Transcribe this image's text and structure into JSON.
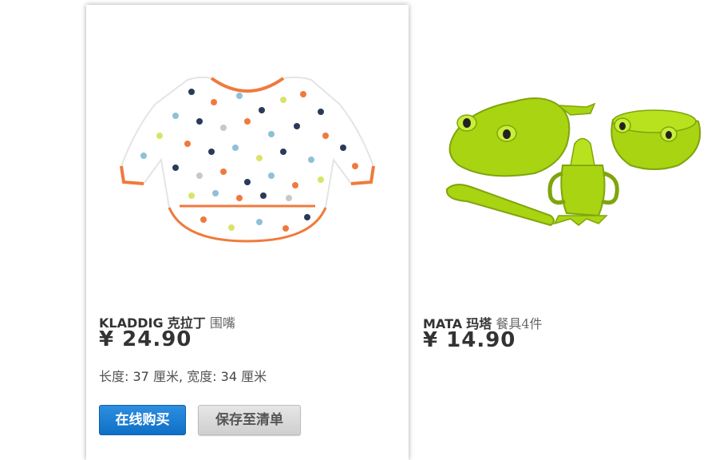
{
  "products": [
    {
      "brand": "KLADDIG",
      "name_cn": "克拉丁",
      "description": "围嘴",
      "price": "¥ 24.90",
      "dims_label_length": "长度",
      "dims_length_value": "37",
      "dims_unit_1": "厘米",
      "dims_label_width": "宽度",
      "dims_width_value": "34",
      "dims_unit_2": "厘米",
      "buy_label": "在线购买",
      "save_label": "保存至清单",
      "image": "bib-with-sleeves-polka-dots"
    },
    {
      "brand": "MATA",
      "name_cn": "玛塔",
      "description": "餐具4件",
      "price": "¥ 14.90",
      "image": "green-frog-dinnerware-set"
    }
  ],
  "colors": {
    "buy_button": "#1a7fd4",
    "save_button": "#d9d9d9",
    "frog_green": "#a8d412",
    "bib_trim": "#f07a3c"
  }
}
